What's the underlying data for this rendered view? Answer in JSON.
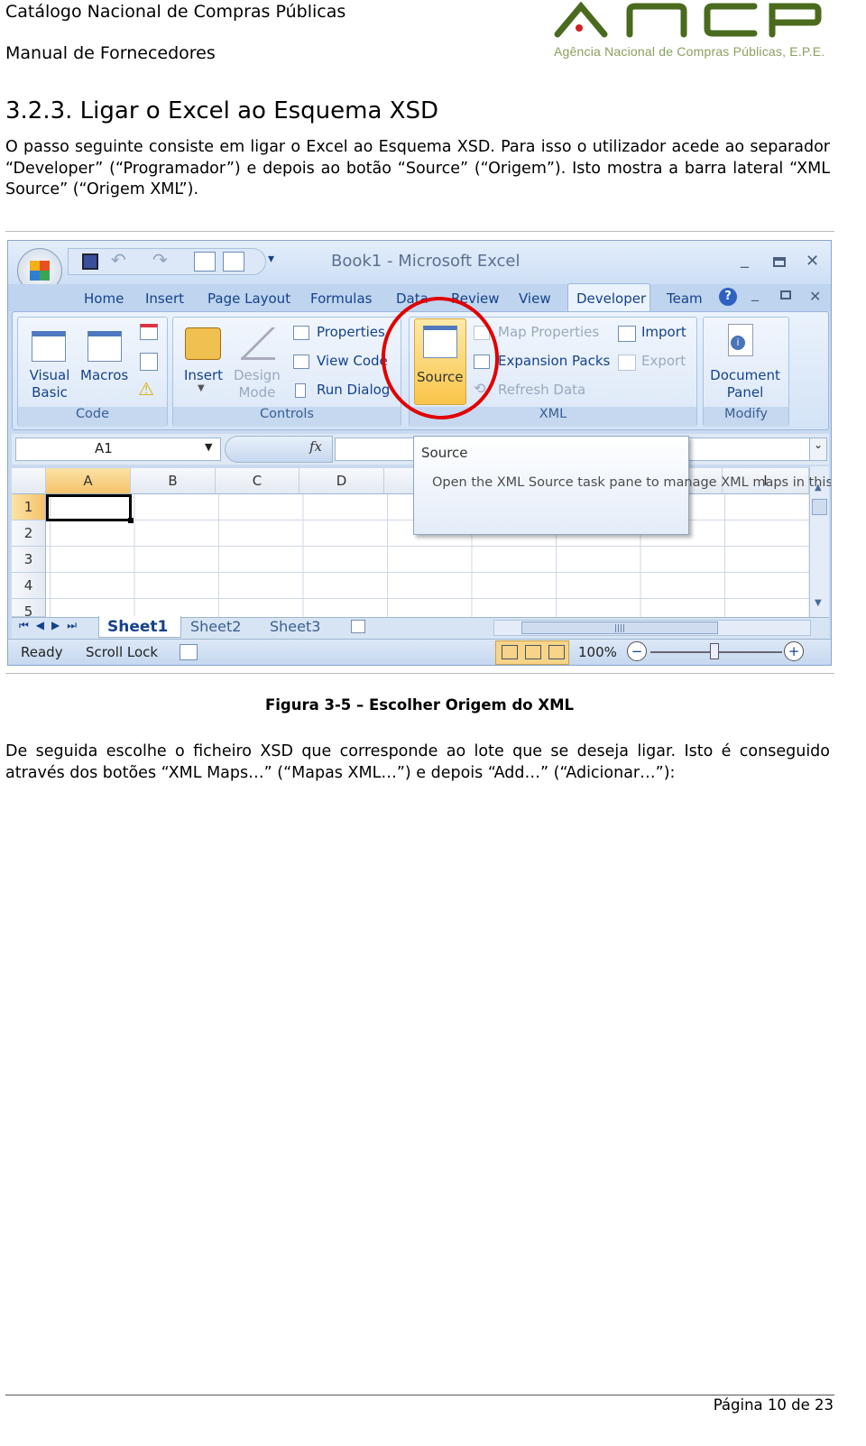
{
  "header": {
    "title": "Catálogo Nacional de Compras Públicas",
    "subtitle": "Manual de Fornecedores",
    "logo_text": "ANCP",
    "logo_subtitle": "Agência Nacional de Compras Públicas, E.P.E.",
    "logo_color": "#4a6a1e"
  },
  "section": {
    "heading": "3.2.3. Ligar o Excel ao Esquema XSD",
    "para1": "O passo seguinte consiste em ligar o Excel ao Esquema XSD. Para isso o utilizador acede ao separador “Developer” (“Programador”) e depois ao botão “Source” (“Origem”). Isto mostra a barra lateral “XML Source” (“Origem XML”).",
    "caption": "Figura 3-5 – Escolher Origem do XML",
    "para2": "De seguida escolhe o ficheiro XSD que corresponde ao lote que se deseja ligar. Isto é conseguido através dos botões “XML Maps…” (“Mapas XML…”) e depois “Add…” (“Adicionar…”):"
  },
  "excel": {
    "window_title": "Book1 - Microsoft Excel",
    "tabs": [
      "Home",
      "Insert",
      "Page Layout",
      "Formulas",
      "Data",
      "Review",
      "View",
      "Developer",
      "Team"
    ],
    "active_tab": "Developer",
    "groups": {
      "code": {
        "label": "Code",
        "visual_basic": "Visual\nBasic",
        "macros": "Macros"
      },
      "controls": {
        "label": "Controls",
        "insert": "Insert",
        "design_mode": "Design\nMode",
        "properties": "Properties",
        "view_code": "View Code",
        "run_dialog": "Run Dialog"
      },
      "xml": {
        "label": "XML",
        "source": "Source",
        "map_properties": "Map Properties",
        "expansion_packs": "Expansion Packs",
        "refresh_data": "Refresh Data",
        "import": "Import",
        "export": "Export"
      },
      "modify": {
        "label": "Modify",
        "document_panel": "Document\nPanel"
      }
    },
    "name_box": "A1",
    "fx": "fx",
    "columns": [
      "A",
      "B",
      "C",
      "D",
      "I"
    ],
    "rows": [
      "1",
      "2",
      "3",
      "4",
      "5"
    ],
    "tooltip": {
      "title": "Source",
      "body": "Open the XML Source task pane to manage XML maps in this workbook."
    },
    "sheets": [
      "Sheet1",
      "Sheet2",
      "Sheet3"
    ],
    "active_sheet": "Sheet1",
    "status": {
      "ready": "Ready",
      "scroll_lock": "Scroll Lock",
      "zoom": "100%"
    },
    "zoom_percent": 100,
    "highlight_color": "#e00000"
  },
  "footer": {
    "page": "Página 10 de 23"
  }
}
